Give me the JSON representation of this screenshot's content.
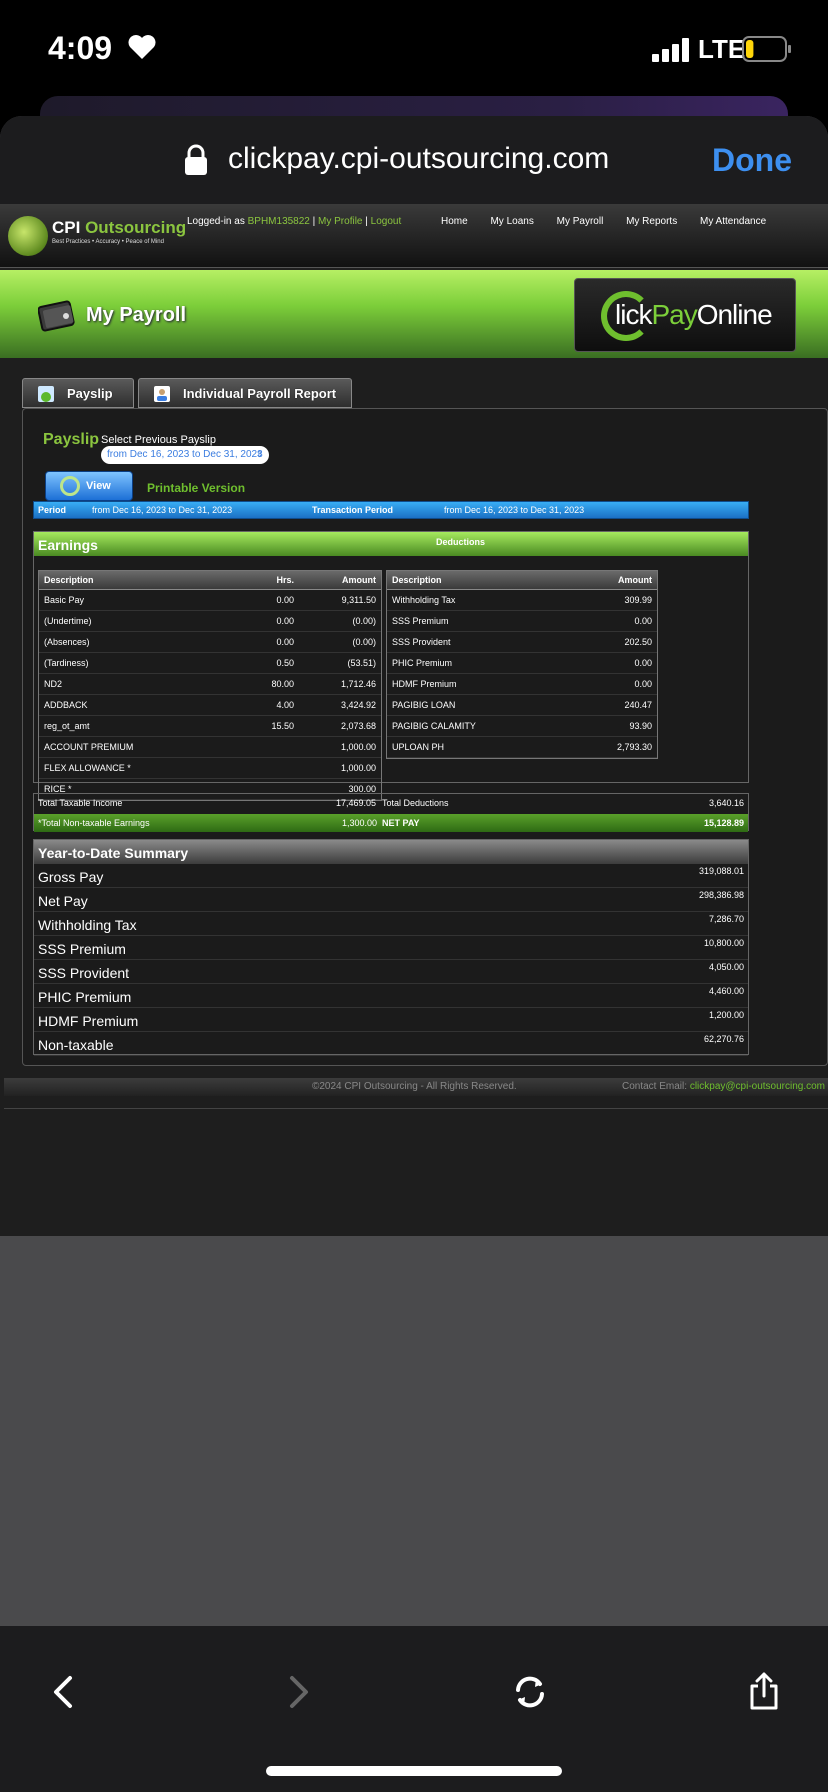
{
  "status": {
    "time": "4:09",
    "network": "LTE"
  },
  "browser": {
    "url": "clickpay.cpi-outsourcing.com",
    "done_label": "Done"
  },
  "site": {
    "brand": "CPI Outsourcing",
    "brand_prefix": "CPI ",
    "brand_suffix": "Outsourcing",
    "tagline": "Best Practices • Accuracy • Peace of Mind",
    "logged_prefix": "Logged-in as ",
    "user_id": "BPHM135822",
    "sep1": " | ",
    "my_profile": "My Profile",
    "sep2": " | ",
    "logout": "Logout",
    "nav": [
      "Home",
      "My Loans",
      "My Payroll",
      "My Reports",
      "My Attendance"
    ]
  },
  "banner": {
    "title": "My Payroll",
    "logo_c": "lick",
    "logo_pay": "Pay",
    "logo_online": "Online"
  },
  "tabs": [
    "Payslip",
    "Individual Payroll Report"
  ],
  "payslip": {
    "title": "Payslip",
    "select_label": "Select Previous Payslip",
    "selected_period": "from Dec 16, 2023 to Dec 31, 2023",
    "view_label": "View",
    "printable_label": "Printable Version",
    "period_label": "Period",
    "period_value": "from Dec 16, 2023 to Dec 31, 2023",
    "transaction_label": "Transaction Period",
    "transaction_value": "from Dec 16, 2023 to Dec 31, 2023"
  },
  "earnings": {
    "title": "Earnings",
    "columns": [
      "Description",
      "Hrs.",
      "Amount"
    ],
    "rows": [
      {
        "d": "Basic Pay",
        "h": "0.00",
        "a": "9,311.50"
      },
      {
        "d": "(Undertime)",
        "h": "0.00",
        "a": "(0.00)"
      },
      {
        "d": "(Absences)",
        "h": "0.00",
        "a": "(0.00)"
      },
      {
        "d": "(Tardiness)",
        "h": "0.50",
        "a": "(53.51)"
      },
      {
        "d": "ND2",
        "h": "80.00",
        "a": "1,712.46"
      },
      {
        "d": "ADDBACK",
        "h": "4.00",
        "a": "3,424.92"
      },
      {
        "d": "reg_ot_amt",
        "h": "15.50",
        "a": "2,073.68"
      },
      {
        "d": "ACCOUNT PREMIUM",
        "h": "",
        "a": "1,000.00"
      },
      {
        "d": "FLEX ALLOWANCE *",
        "h": "",
        "a": "1,000.00"
      },
      {
        "d": "RICE *",
        "h": "",
        "a": "300.00"
      }
    ]
  },
  "deductions": {
    "title": "Deductions",
    "columns": [
      "Description",
      "Amount"
    ],
    "rows": [
      {
        "d": "Withholding Tax",
        "a": "309.99"
      },
      {
        "d": "SSS Premium",
        "a": "0.00"
      },
      {
        "d": "SSS Provident",
        "a": "202.50"
      },
      {
        "d": "PHIC Premium",
        "a": "0.00"
      },
      {
        "d": "HDMF Premium",
        "a": "0.00"
      },
      {
        "d": "PAGIBIG LOAN",
        "a": "240.47"
      },
      {
        "d": "PAGIBIG CALAMITY",
        "a": "93.90"
      },
      {
        "d": "UPLOAN PH",
        "a": "2,793.30"
      }
    ]
  },
  "totals": {
    "taxable_label": "Total Taxable Income",
    "taxable_value": "17,469.05",
    "deductions_label": "Total Deductions",
    "deductions_value": "3,640.16",
    "nontaxable_label": "*Total Non-taxable Earnings",
    "nontaxable_value": "1,300.00",
    "netpay_label": "NET PAY",
    "netpay_value": "15,128.89"
  },
  "ytd": {
    "title": "Year-to-Date Summary",
    "rows": [
      {
        "l": "Gross Pay",
        "v": "319,088.01"
      },
      {
        "l": "Net Pay",
        "v": "298,386.98"
      },
      {
        "l": "Withholding Tax",
        "v": "7,286.70"
      },
      {
        "l": "SSS Premium",
        "v": "10,800.00"
      },
      {
        "l": "SSS Provident",
        "v": "4,050.00"
      },
      {
        "l": "PHIC Premium",
        "v": "4,460.00"
      },
      {
        "l": "HDMF Premium",
        "v": "1,200.00"
      },
      {
        "l": "Non-taxable",
        "v": "62,270.76"
      }
    ]
  },
  "footer": {
    "copyright": "©2024 CPI Outsourcing - All Rights Reserved.",
    "contact_label": "Contact Email: ",
    "contact_email": "clickpay@cpi-outsourcing.com"
  },
  "colors": {
    "accent_green": "#8bc53f",
    "link_blue": "#3d8ff0",
    "period_blue": "#1b70c4"
  },
  "battery_level": 0.2
}
